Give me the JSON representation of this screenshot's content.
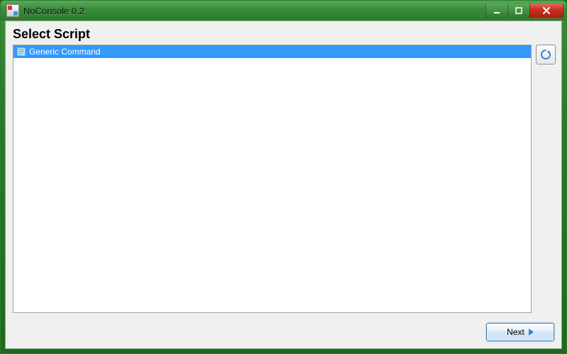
{
  "window": {
    "title": "NoConsole 0.2"
  },
  "page": {
    "heading": "Select Script"
  },
  "scripts": {
    "items": [
      {
        "label": "Generic Command",
        "selected": true
      }
    ]
  },
  "buttons": {
    "next": "Next"
  }
}
